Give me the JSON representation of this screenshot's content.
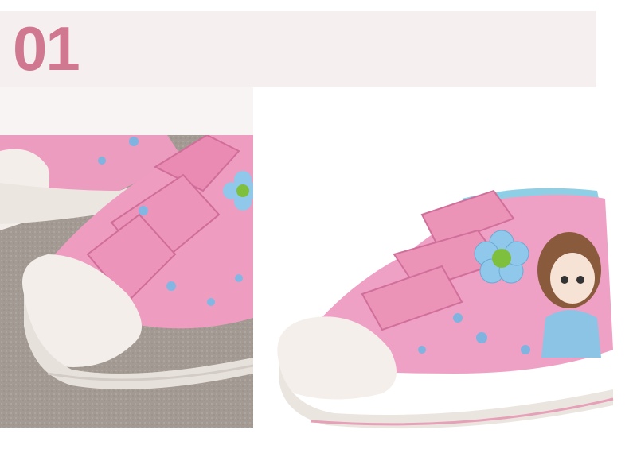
{
  "header": {
    "number": "01",
    "number_color": "#d0788f",
    "band_color": "#f6eff0"
  },
  "closeup": {
    "icon": "shoe-closeup-photo",
    "carpet_color": "#a39a93",
    "canvas_color": "#ee9cc0",
    "rubber_color": "#f3eeea"
  },
  "product": {
    "icon": "pink-girls-sneaker-photo",
    "canvas_color": "#efa0c5",
    "lining_color": "#8fcfe6",
    "flower_color": "#8fc8ea",
    "flower_center_color": "#7fbf3e",
    "rubber_color": "#f4efea"
  }
}
